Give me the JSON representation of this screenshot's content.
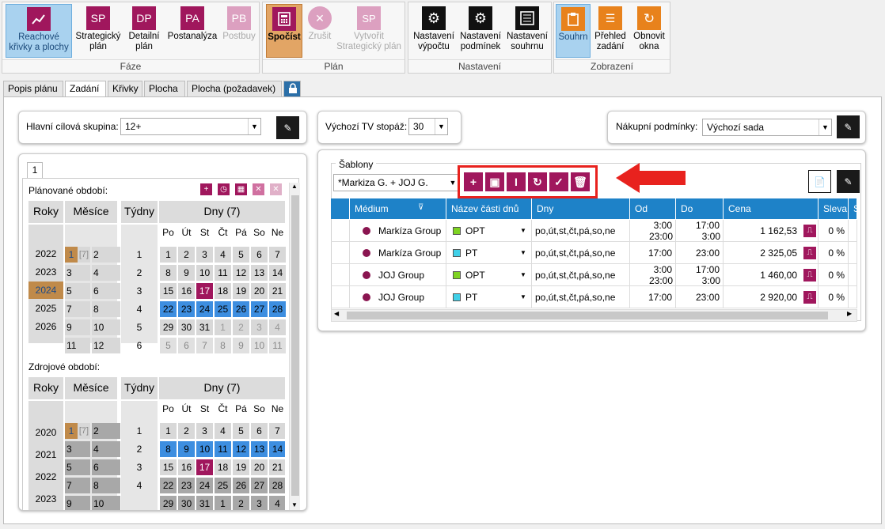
{
  "ribbon": {
    "groups": [
      {
        "label": "Fáze"
      },
      {
        "label": "Plán"
      },
      {
        "label": "Nastavení"
      },
      {
        "label": "Zobrazení"
      }
    ],
    "buttons": {
      "reach": "Reachové\nkřivky a plochy",
      "sp": "SP",
      "sp_label": "Strategický\nplán",
      "dp": "DP",
      "dp_label": "Detailní\nplán",
      "pa": "PA",
      "pa_label": "Postanalýza",
      "pb": "PB",
      "pb_label": "Postbuy",
      "spocist": "Spočíst",
      "zrusit": "Zrušit",
      "vytvorit": "Vytvořit\nStrategický plán",
      "nast_vypoctu": "Nastavení\nvýpočtu",
      "nast_podminek": "Nastavení\npodmínek",
      "nast_souhrnu": "Nastavení\nsouhrnu",
      "souhrn": "Souhrn",
      "prehled": "Přehled\nzadání",
      "obnovit": "Obnovit\nokna"
    }
  },
  "tabs": [
    "Popis plánu",
    "Zadání",
    "Křivky",
    "Plocha",
    "Plocha (požadavek)"
  ],
  "target": {
    "label": "Hlavní cílová skupina:",
    "value": "12+"
  },
  "footage": {
    "label": "Výchozí TV stopáž:",
    "value": "30"
  },
  "purchase": {
    "label": "Nákupní podmínky:",
    "value": "Výchozí sada"
  },
  "calendar": {
    "tab": "1",
    "planned_label": "Plánované období:",
    "source_label": "Zdrojové období:",
    "h_roky": "Roky",
    "h_mesice": "Měsíce",
    "h_tydny": "Týdny",
    "h_dny": "Dny (7)",
    "weekdays": [
      "Po",
      "Út",
      "St",
      "Čt",
      "Pá",
      "So",
      "Ne"
    ],
    "planned_years": [
      "2022",
      "2023",
      "2024",
      "2025",
      "2026"
    ],
    "planned_months": [
      "1",
      "[7]",
      "2",
      "3",
      "4",
      "5",
      "6",
      "7",
      "8",
      "9",
      "10",
      "11",
      "12"
    ],
    "weeks": [
      "1",
      "2",
      "3",
      "4",
      "5",
      "6"
    ],
    "planned_days": [
      [
        "1",
        "2",
        "3",
        "4",
        "5",
        "6",
        "7"
      ],
      [
        "8",
        "9",
        "10",
        "11",
        "12",
        "13",
        "14"
      ],
      [
        "15",
        "16",
        "17",
        "18",
        "19",
        "20",
        "21"
      ],
      [
        "22",
        "23",
        "24",
        "25",
        "26",
        "27",
        "28"
      ],
      [
        "29",
        "30",
        "31",
        "1",
        "2",
        "3",
        "4"
      ],
      [
        "5",
        "6",
        "7",
        "8",
        "9",
        "10",
        "11"
      ]
    ],
    "source_years": [
      "2020",
      "2021",
      "2022",
      "2023"
    ],
    "source_months": [
      "1",
      "[7]",
      "2",
      "3",
      "4",
      "5",
      "6",
      "7",
      "8",
      "9",
      "10"
    ],
    "source_weeks": [
      "1",
      "2",
      "3",
      "4"
    ],
    "source_days": [
      [
        "1",
        "2",
        "3",
        "4",
        "5",
        "6",
        "7"
      ],
      [
        "8",
        "9",
        "10",
        "11",
        "12",
        "13",
        "14"
      ],
      [
        "15",
        "16",
        "17",
        "18",
        "19",
        "20",
        "21"
      ],
      [
        "22",
        "23",
        "24",
        "25",
        "26",
        "27",
        "28"
      ],
      [
        "29",
        "30",
        "31",
        "1",
        "2",
        "3",
        "4"
      ]
    ]
  },
  "templates": {
    "legend": "Šablony",
    "value": "*Markiza G. + JOJ G.",
    "columns": [
      "Médium",
      "Název části dnů",
      "Dny",
      "Od",
      "Do",
      "Cena",
      "Sleva",
      "S"
    ],
    "rows": [
      {
        "medium": "Markíza Group",
        "part": "OPT",
        "part_color": "#7ed321",
        "days": "po,út,st,čt,pá,so,ne",
        "od1": "3:00",
        "od2": "23:00",
        "do1": "17:00",
        "do2": "3:00",
        "cena": "1 162,53",
        "sleva": "0 %"
      },
      {
        "medium": "Markíza Group",
        "part": "PT",
        "part_color": "#40d0e8",
        "days": "po,út,st,čt,pá,so,ne",
        "od1": "17:00",
        "od2": "",
        "do1": "23:00",
        "do2": "",
        "cena": "2 325,05",
        "sleva": "0 %"
      },
      {
        "medium": "JOJ Group",
        "part": "OPT",
        "part_color": "#7ed321",
        "days": "po,út,st,čt,pá,so,ne",
        "od1": "3:00",
        "od2": "23:00",
        "do1": "17:00",
        "do2": "3:00",
        "cena": "1 460,00",
        "sleva": "0 %"
      },
      {
        "medium": "JOJ Group",
        "part": "PT",
        "part_color": "#40d0e8",
        "days": "po,út,st,čt,pá,so,ne",
        "od1": "17:00",
        "od2": "",
        "do1": "23:00",
        "do2": "",
        "cena": "2 920,00",
        "sleva": "0 %"
      }
    ]
  },
  "colors": {
    "accent": "#a0175d",
    "header": "#1e82c8",
    "highlight": "#e8221e",
    "selected_week": "#3d8ee0"
  }
}
